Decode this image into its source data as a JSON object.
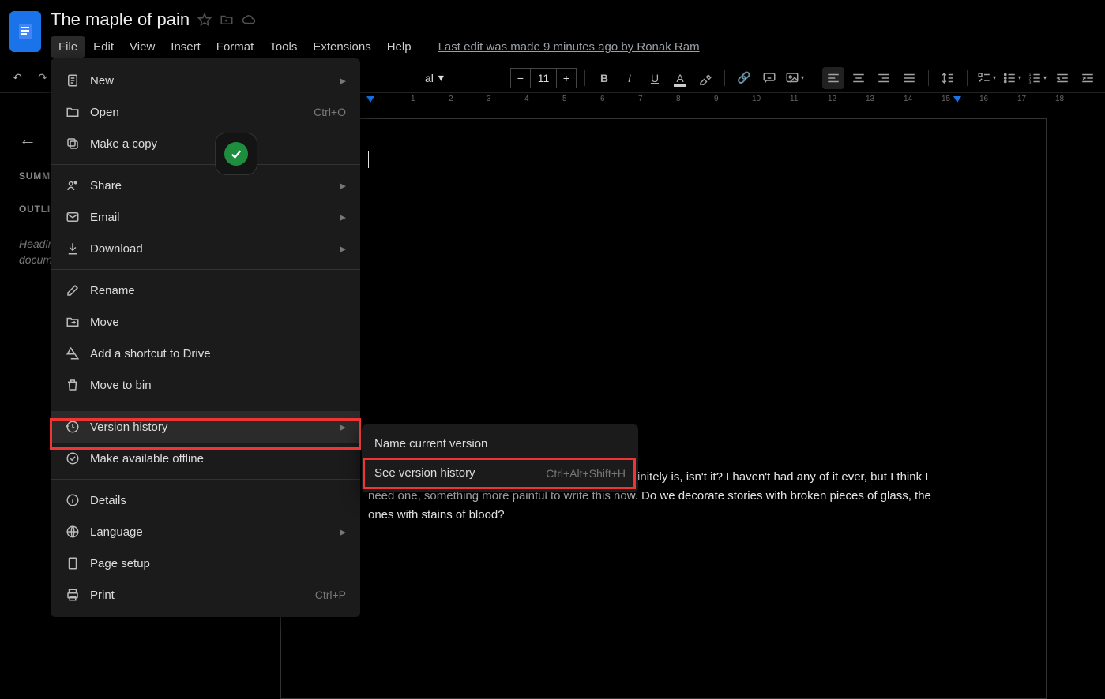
{
  "app": {
    "title": "The maple of pain"
  },
  "menubar": {
    "items": [
      "File",
      "Edit",
      "View",
      "Insert",
      "Format",
      "Tools",
      "Extensions",
      "Help"
    ],
    "active_index": 0,
    "last_edit": "Last edit was made 9 minutes ago by Ronak Ram"
  },
  "toolbar": {
    "font_size": "11",
    "style_label": "al"
  },
  "sidebar": {
    "summary_label": "SUMMARY",
    "outline_label": "OUTLINE",
    "outline_empty": "Headings that you add to the document will appear here."
  },
  "document": {
    "body": "I was just thinking if tattoos are painful. Piercing definitely is, isn't it? I haven't had any of it ever, but I think I need one, something more painful to write this now. Do we decorate stories with broken pieces of glass, the ones with stains of blood?"
  },
  "ruler": {
    "ticks": [
      "1",
      "2",
      "3",
      "4",
      "5",
      "6",
      "7",
      "8",
      "9",
      "10",
      "11",
      "12",
      "13",
      "14",
      "15",
      "16",
      "17",
      "18"
    ]
  },
  "file_menu": {
    "items": [
      {
        "icon": "doc-icon",
        "label": "New",
        "submenu": true
      },
      {
        "icon": "folder-icon",
        "label": "Open",
        "shortcut": "Ctrl+O"
      },
      {
        "icon": "copy-icon",
        "label": "Make a copy"
      },
      {
        "sep": true
      },
      {
        "icon": "share-icon",
        "label": "Share",
        "submenu": true
      },
      {
        "icon": "email-icon",
        "label": "Email",
        "submenu": true
      },
      {
        "icon": "download-icon",
        "label": "Download",
        "submenu": true
      },
      {
        "sep": true
      },
      {
        "icon": "rename-icon",
        "label": "Rename"
      },
      {
        "icon": "move-icon",
        "label": "Move"
      },
      {
        "icon": "drive-shortcut-icon",
        "label": "Add a shortcut to Drive"
      },
      {
        "icon": "trash-icon",
        "label": "Move to bin"
      },
      {
        "sep": true
      },
      {
        "icon": "history-icon",
        "label": "Version history",
        "submenu": true,
        "hover": true
      },
      {
        "icon": "offline-icon",
        "label": "Make available offline"
      },
      {
        "sep": true
      },
      {
        "icon": "info-icon",
        "label": "Details"
      },
      {
        "icon": "globe-icon",
        "label": "Language",
        "submenu": true
      },
      {
        "icon": "page-setup-icon",
        "label": "Page setup"
      },
      {
        "icon": "print-icon",
        "label": "Print",
        "shortcut": "Ctrl+P"
      }
    ]
  },
  "version_submenu": {
    "items": [
      {
        "label": "Name current version"
      },
      {
        "label": "See version history",
        "shortcut": "Ctrl+Alt+Shift+H"
      }
    ]
  },
  "icons": {
    "undo": "↶",
    "redo": "↷",
    "printer": "🖶",
    "spell": "Ⓐ",
    "paint": "🖌",
    "bold": "B",
    "italic": "I",
    "underline": "U",
    "link": "🔗",
    "comment": "🗨",
    "image": "🖼",
    "chev": "▸",
    "tri": "▾",
    "check": "✓"
  }
}
